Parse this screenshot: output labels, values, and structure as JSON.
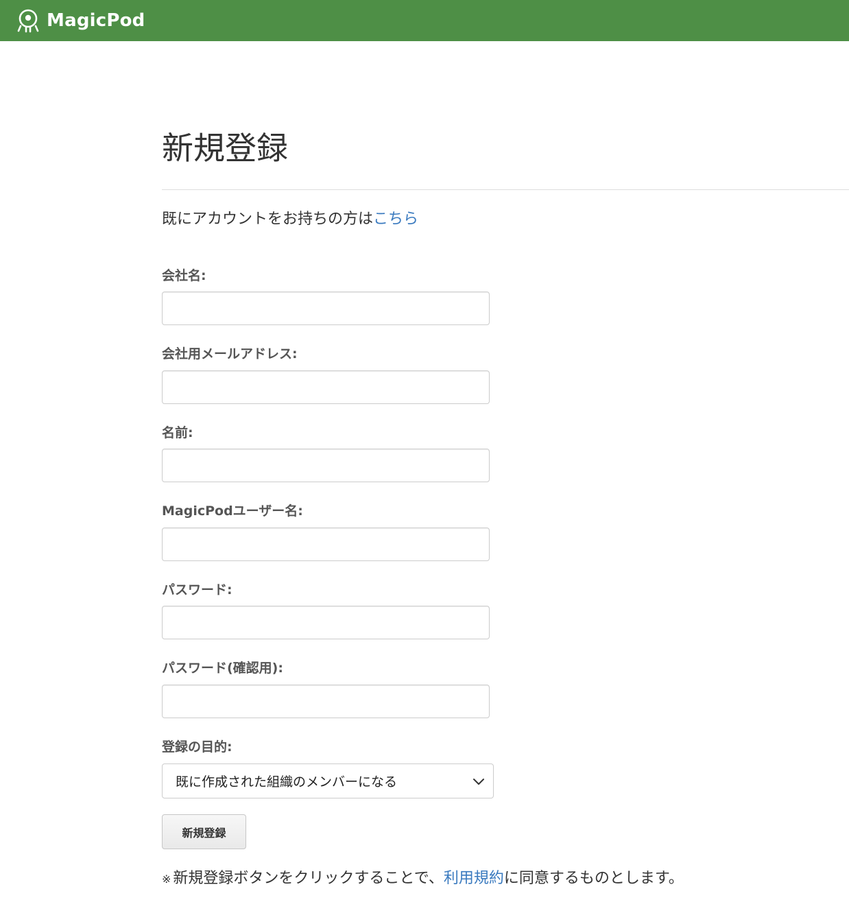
{
  "header": {
    "brand_name": "MagicPod",
    "brand_color": "#4e8f46"
  },
  "page": {
    "title": "新規登録",
    "login_prompt": "既にアカウントをお持ちの方は",
    "login_link": "こちら"
  },
  "form": {
    "company_name_label": "会社名:",
    "company_name_value": "",
    "company_email_label": "会社用メールアドレス:",
    "company_email_value": "",
    "name_label": "名前:",
    "name_value": "",
    "username_label": "MagicPodユーザー名:",
    "username_value": "",
    "password_label": "パスワード:",
    "password_value": "",
    "password_confirm_label": "パスワード(確認用):",
    "password_confirm_value": "",
    "purpose_label": "登録の目的:",
    "purpose_selected": "既に作成された組織のメンバーになる",
    "submit_label": "新規登録"
  },
  "footer_note": {
    "mark": "※",
    "prefix": "新規登録ボタンをクリックすることで、",
    "terms_link": "利用規約",
    "suffix": "に同意するものとします。"
  },
  "icons": {
    "brand_logo": "magicpod-logo-icon",
    "select_arrow": "chevron-down-icon"
  }
}
